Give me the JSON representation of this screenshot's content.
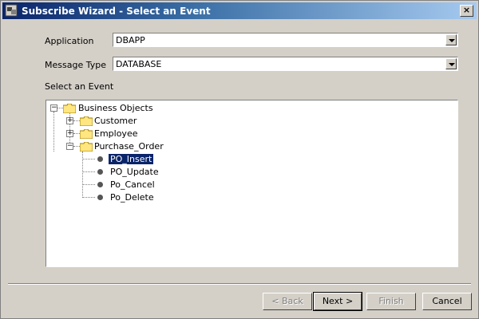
{
  "window": {
    "title": "Subscribe Wizard  - Select an Event",
    "close_symbol": "×"
  },
  "form": {
    "application_label": "Application",
    "application_value": "DBAPP",
    "message_type_label": "Message Type",
    "message_type_value": "DATABASE",
    "event_label": "Select an Event"
  },
  "tree": {
    "root": "Business Objects",
    "collapsed_symbol": "+",
    "expanded_symbol": "−",
    "folders": [
      "Customer",
      "Employee",
      "Purchase_Order"
    ],
    "events": [
      "PO_Insert",
      "PO_Update",
      "Po_Cancel",
      "Po_Delete"
    ],
    "selected": "PO_Insert"
  },
  "buttons": {
    "back": "< Back",
    "next": "Next >",
    "finish": "Finish",
    "cancel": "Cancel"
  },
  "colors": {
    "title_bar": "#0a246a",
    "selection": "#0a246a",
    "face": "#d4d0c8"
  }
}
